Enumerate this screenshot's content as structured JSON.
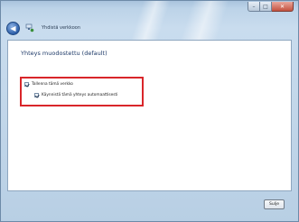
{
  "nav": {
    "title": "Yhdistä verkkoon"
  },
  "main": {
    "heading": "Yhteys muodostettu (default)",
    "options": [
      {
        "label": "Tallenna tämä verkko",
        "checked": true
      },
      {
        "label": "Käynnistä tämä yhteys automaattisesti",
        "checked": true
      }
    ]
  },
  "footer": {
    "close_label": "Sulje"
  },
  "colors": {
    "highlight": "#d9262a",
    "heading": "#1e3a68"
  },
  "icons": {
    "back": "back-arrow-icon",
    "network": "network-icon"
  }
}
